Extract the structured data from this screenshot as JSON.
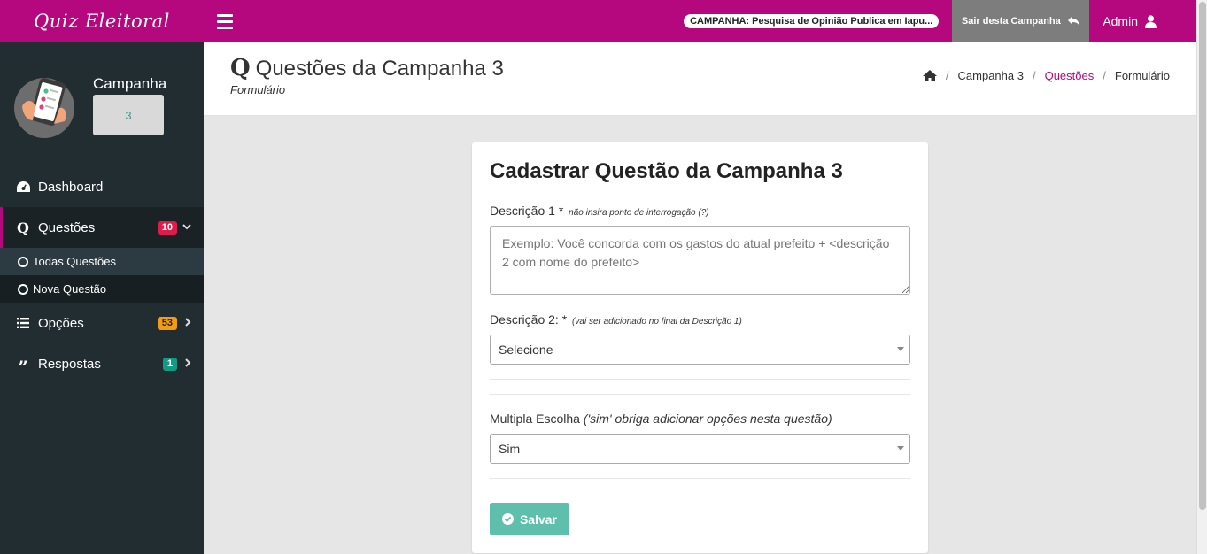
{
  "topbar": {
    "brand": "Quiz Eleitoral",
    "campaign_pill": "CAMPANHA: Pesquisa de Opinião Publica em Iapu...",
    "exit_label": "Sair desta Campanha",
    "admin_label": "Admin"
  },
  "sidebar": {
    "campaign_label": "Campanha",
    "campaign_number": "3",
    "items": [
      {
        "label": "Dashboard",
        "icon": "dashboard-icon"
      },
      {
        "label": "Questões",
        "icon": "q-icon",
        "badge": "10",
        "badge_color": "#dd1c49",
        "active": true
      },
      {
        "label": "Opções",
        "icon": "list-icon",
        "badge": "53",
        "badge_color": "#f39c12"
      },
      {
        "label": "Respostas",
        "icon": "quote-icon",
        "badge": "1",
        "badge_color": "#119b84"
      }
    ],
    "subitems": [
      {
        "label": "Todas Questões"
      },
      {
        "label": "Nova Questão"
      }
    ]
  },
  "header": {
    "title_icon": "Q",
    "title": "Questões da Campanha 3",
    "subtitle": "Formulário",
    "breadcrumb": [
      "Campanha 3",
      "Questões",
      "Formulário"
    ]
  },
  "form": {
    "title": "Cadastrar Questão da Campanha 3",
    "desc1_label": "Descrição 1",
    "desc1_required": "*",
    "desc1_hint": "não insira ponto de interrogação (?)",
    "desc1_placeholder": "Exemplo: Você concorda com os gastos do atual prefeito + <descrição 2 com nome do prefeito>",
    "desc2_label": "Descrição 2:",
    "desc2_required": "*",
    "desc2_hint": "(vai ser adicionado no final da Descrição 1)",
    "desc2_value": "Selecione",
    "multi_label": "Multipla Escolha",
    "multi_hint": "('sim' obriga adicionar opções nesta questão)",
    "multi_value": "Sim",
    "save_label": "Salvar"
  },
  "colors": {
    "brand": "#b5087e",
    "sidebar": "#222d32",
    "save_button": "#5fbfad"
  }
}
